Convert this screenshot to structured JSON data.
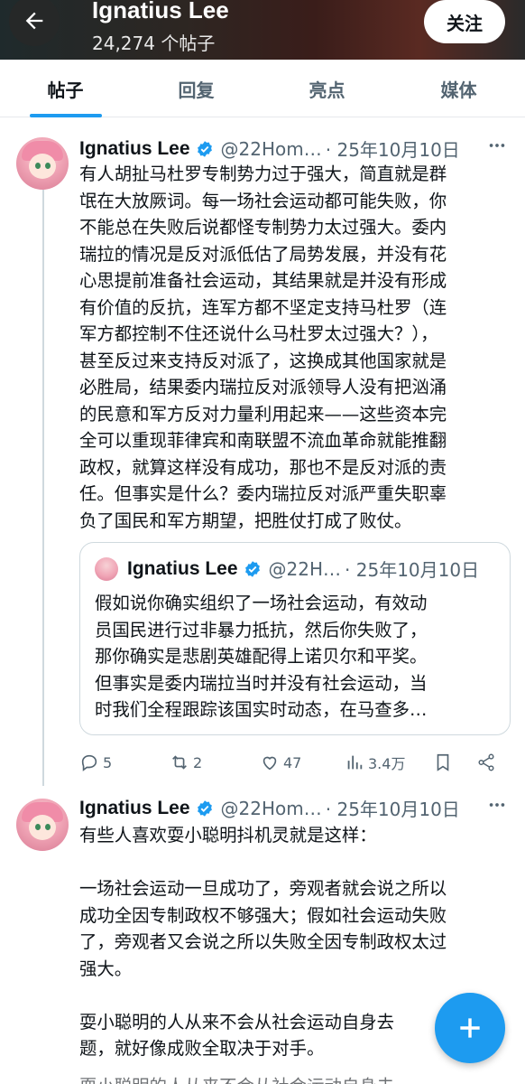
{
  "header": {
    "title": "Ignatius Lee",
    "subtitle": "24,274 个帖子",
    "follow_label": "关注"
  },
  "tabs": [
    {
      "label": "帖子",
      "active": true
    },
    {
      "label": "回复",
      "active": false
    },
    {
      "label": "亮点",
      "active": false
    },
    {
      "label": "媒体",
      "active": false
    }
  ],
  "tweets": [
    {
      "name": "Ignatius Lee",
      "handle": "@22Hom…",
      "date": "· 25年10月10日",
      "text": "有人胡扯马杜罗专制势力过于强大，简直就是群\n氓在大放厥词。每一场社会运动都可能失败，你\n不能总在失败后说都怪专制势力太过强大。委内\n瑞拉的情况是反对派低估了局势发展，并没有花\n心思提前准备社会运动，其结果就是并没有形成\n有价值的反抗，连军方都不坚定支持马杜罗（连\n军方都控制不住还说什么马杜罗太过强大？），\n甚至反过来支持反对派了，这换成其他国家就是\n必胜局，结果委内瑞拉反对派领导人没有把汹涌\n的民意和军方反对力量利用起来——这些资本完\n全可以重现菲律宾和南联盟不流血革命就能推翻\n政权，就算这样没有成功，那也不是反对派的责\n任。但事实是什么？委内瑞拉反对派严重失职辜\n负了国民和军方期望，把胜仗打成了败仗。",
      "quote": {
        "name": "Ignatius Lee",
        "handle": "@22H…",
        "date": "· 25年10月10日",
        "text": "假如说你确实组织了一场社会运动，有效动\n员国民进行过非暴力抵抗，然后你失败了，\n那你确实是悲剧英雄配得上诺贝尔和平奖。\n但事实是委内瑞拉当时并没有社会运动，当\n时我们全程跟踪该国实时动态，在马查多…"
      },
      "actions": {
        "replies": "5",
        "retweets": "2",
        "likes": "47",
        "views": "3.4万"
      }
    },
    {
      "name": "Ignatius Lee",
      "handle": "@22Hom…",
      "date": "· 25年10月10日",
      "text": "有些人喜欢耍小聪明抖机灵就是这样：\n\n一场社会运动一旦成功了，旁观者就会说之所以\n成功全因专制政权不够强大；假如社会运动失败\n了，旁观者又会说之所以失败全因专制政权太过\n强大。\n\n耍小聪明的人从来不会从社会运动自身去\n题，就好像成败全取决于对手。",
      "peek": "耍小聪明的人从来不会从社会运动自身去"
    }
  ],
  "icons": {
    "back": "arrow-left-icon",
    "verified": "verified-badge-icon",
    "more": "more-icon",
    "reply": "reply-icon",
    "retweet": "retweet-icon",
    "like": "heart-icon",
    "views": "views-icon",
    "bookmark": "bookmark-icon",
    "share": "share-icon",
    "fab": "plus-icon"
  },
  "colors": {
    "accent": "#1d9bf0",
    "muted": "#536471",
    "text": "#0f1419"
  }
}
